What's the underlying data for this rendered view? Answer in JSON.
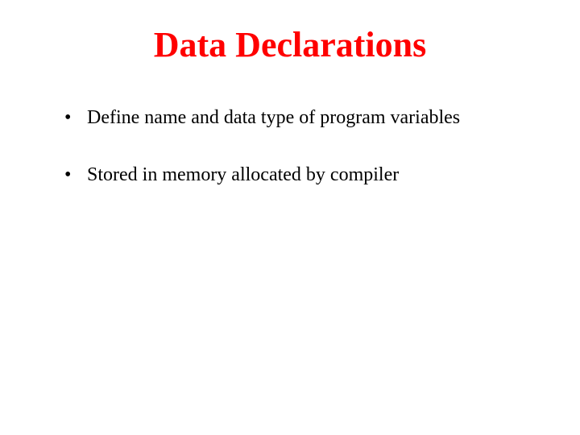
{
  "title": "Data Declarations",
  "bullets": [
    "Define name and data type of program variables",
    "Stored in memory allocated by compiler"
  ]
}
